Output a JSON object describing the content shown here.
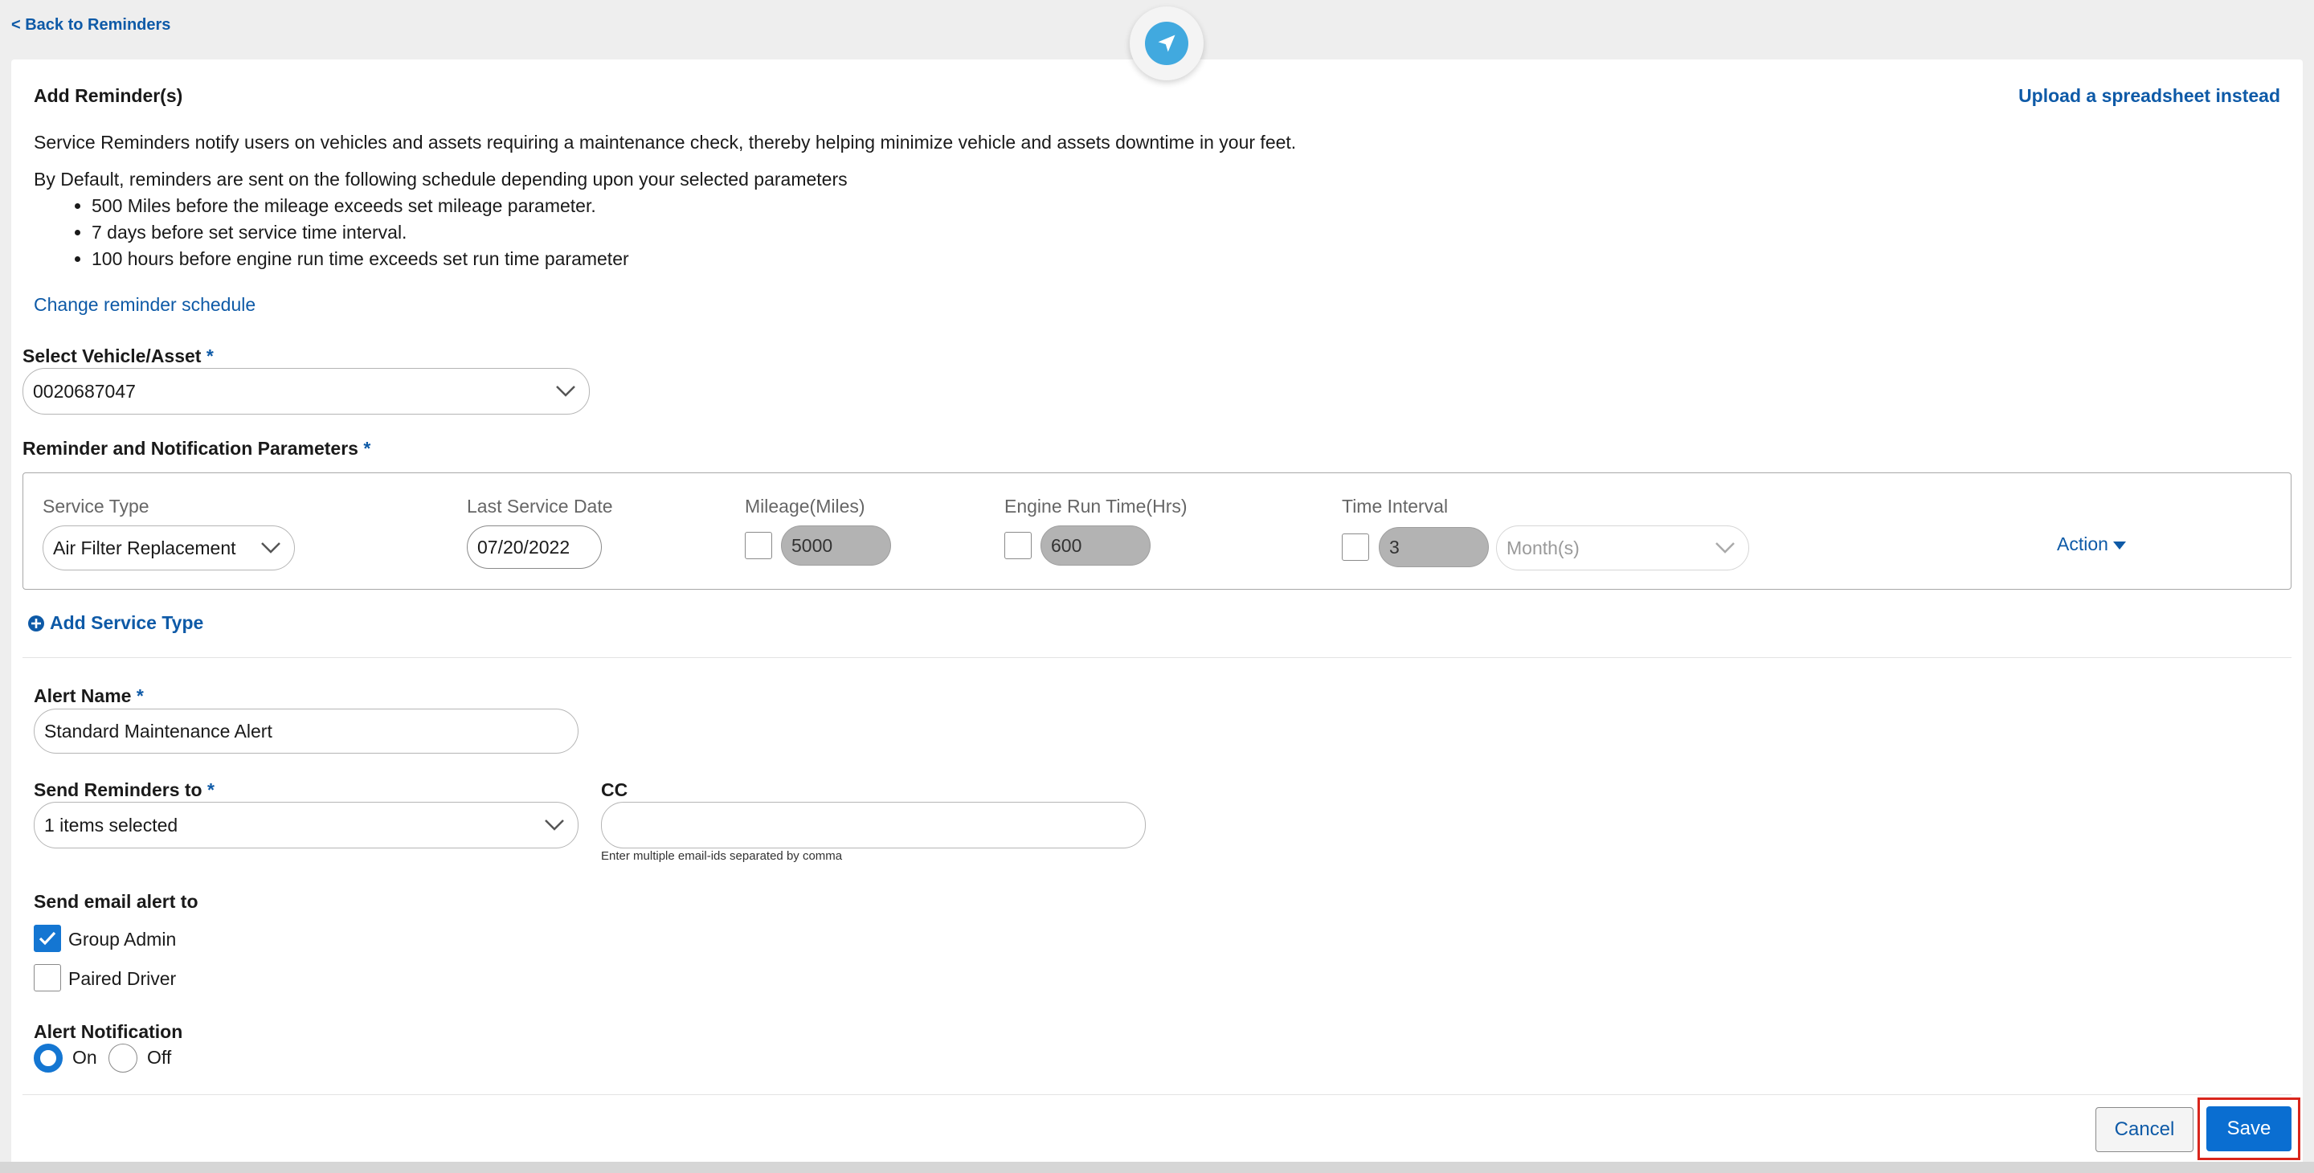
{
  "nav": {
    "back_label": "< Back to Reminders"
  },
  "header": {
    "title": "Add Reminder(s)",
    "upload_link": "Upload a spreadsheet instead"
  },
  "info": {
    "description": "Service Reminders notify users on vehicles and assets requiring a maintenance check, thereby helping minimize vehicle and assets downtime in your feet.",
    "default_intro": "By Default, reminders are sent on the following schedule depending upon your selected parameters",
    "bullets": [
      "500 Miles before the mileage exceeds set mileage parameter.",
      "7 days before set service time interval.",
      "100 hours before engine run time exceeds set run time parameter"
    ],
    "change_link": "Change reminder schedule"
  },
  "vehicle": {
    "label": "Select Vehicle/Asset",
    "required": "*",
    "value": "0020687047"
  },
  "params": {
    "label": "Reminder and Notification Parameters",
    "required": "*",
    "headers": {
      "service_type": "Service Type",
      "last_service_date": "Last Service Date",
      "mileage": "Mileage(Miles)",
      "engine_run_time": "Engine Run Time(Hrs)",
      "time_interval": "Time Interval"
    },
    "row": {
      "service_type": "Air Filter Replacement",
      "last_service_date": "07/20/2022",
      "mileage": "5000",
      "engine_run_time": "600",
      "time_interval": "3",
      "interval_unit": "Month(s)",
      "action": "Action"
    },
    "add_service_type": "Add Service Type"
  },
  "alert": {
    "name_label": "Alert Name",
    "name_required": "*",
    "name_value": "Standard Maintenance Alert",
    "send_to_label": "Send Reminders to",
    "send_to_required": "*",
    "send_to_value": "1 items selected",
    "cc_label": "CC",
    "cc_value": "",
    "cc_helper": "Enter multiple email-ids separated by comma",
    "email_alert_label": "Send email alert to",
    "email_options": [
      {
        "label": "Group Admin",
        "checked": true
      },
      {
        "label": "Paired Driver",
        "checked": false
      }
    ],
    "notification_label": "Alert Notification",
    "notification_on": "On",
    "notification_off": "Off",
    "notification_value": "On"
  },
  "footer": {
    "cancel_label": "Cancel",
    "save_label": "Save"
  },
  "colors": {
    "accent": "#0e5aa7",
    "primary_button": "#0a6ed1",
    "highlight": "#d9251c"
  }
}
